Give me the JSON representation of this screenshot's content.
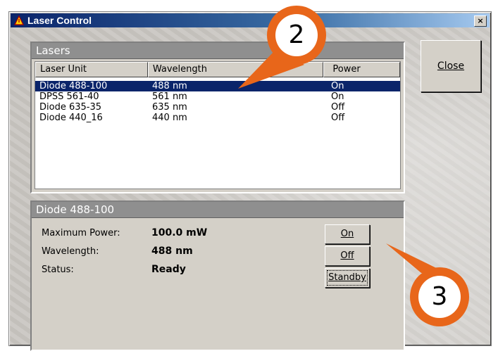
{
  "window": {
    "title": "Laser Control",
    "close_glyph": "×"
  },
  "lasers_panel": {
    "title": "Lasers",
    "columns": [
      "Laser Unit",
      "Wavelength",
      "Power"
    ],
    "rows": [
      {
        "unit": "Diode 488-100",
        "wavelength": "488 nm",
        "power": "On"
      },
      {
        "unit": "DPSS 561-40",
        "wavelength": "561 nm",
        "power": "On"
      },
      {
        "unit": "Diode 635-35",
        "wavelength": "635 nm",
        "power": "Off"
      },
      {
        "unit": "Diode 440_16",
        "wavelength": "440 nm",
        "power": "Off"
      }
    ]
  },
  "detail_panel": {
    "title": "Diode 488-100",
    "max_power_label": "Maximum Power:",
    "max_power_value": "100.0 mW",
    "wavelength_label": "Wavelength:",
    "wavelength_value": "488 nm",
    "status_label": "Status:",
    "status_value": "Ready",
    "buttons": {
      "on": "On",
      "off": "Off",
      "standby": "Standby"
    }
  },
  "close_button": {
    "label": "Close"
  },
  "callouts": [
    "2",
    "3"
  ],
  "colors": {
    "callout_orange": "#e8661a",
    "selection": "#0a246a"
  }
}
